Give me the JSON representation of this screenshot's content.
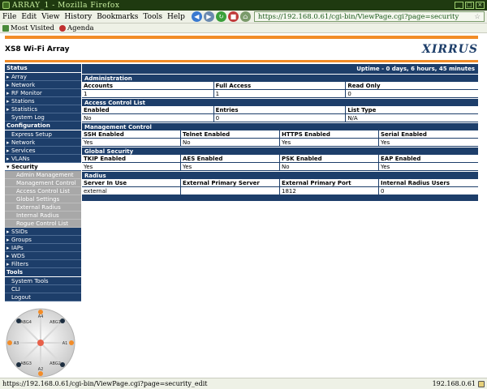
{
  "browser": {
    "window_title": "ARRAY_1 - Mozilla Firefox",
    "menus": [
      "File",
      "Edit",
      "View",
      "History",
      "Bookmarks",
      "Tools",
      "Help"
    ],
    "url": "https://192.168.0.61/cgi-bin/ViewPage.cgi?page=security",
    "bookmarks": [
      "Most Visited",
      "Agenda"
    ]
  },
  "page": {
    "title": "XS8 Wi-Fi Array",
    "logo": "XIRRUS",
    "uptime": "Uptime - 0 days, 6 hours, 45 minutes"
  },
  "sidebar": {
    "status_header": "Status",
    "status_items": [
      "Array",
      "Network",
      "RF Monitor",
      "Stations",
      "Statistics",
      "System Log"
    ],
    "config_header": "Configuration",
    "config_items_top": [
      "Express Setup",
      "Network",
      "Services",
      "VLANs"
    ],
    "security_label": "Security",
    "security_subitems": [
      "Admin Management",
      "Management Control",
      "Access Control List",
      "Global Settings",
      "External Radius",
      "Internal Radius",
      "Rogue Control List"
    ],
    "config_items_bottom": [
      "SSIDs",
      "Groups",
      "IAPs",
      "WDS",
      "Filters"
    ],
    "tools_header": "Tools",
    "tools_items": [
      "System Tools",
      "CLI",
      "Logout"
    ]
  },
  "admin": {
    "title": "Administration",
    "headers": [
      "Accounts",
      "Full Access",
      "Read Only"
    ],
    "values": [
      "1",
      "1",
      "0"
    ]
  },
  "acl": {
    "title": "Access Control List",
    "headers": [
      "Enabled",
      "Entries",
      "List Type"
    ],
    "values": [
      "No",
      "0",
      "N/A"
    ]
  },
  "mgmt": {
    "title": "Management Control",
    "headers": [
      "SSH Enabled",
      "Telnet Enabled",
      "HTTPS Enabled",
      "Serial Enabled"
    ],
    "values": [
      "Yes",
      "No",
      "Yes",
      "Yes"
    ]
  },
  "global": {
    "title": "Global Security",
    "headers": [
      "TKIP Enabled",
      "AES Enabled",
      "PSK Enabled",
      "EAP Enabled"
    ],
    "values": [
      "Yes",
      "Yes",
      "No",
      "Yes"
    ]
  },
  "radius": {
    "title": "Radius",
    "headers": [
      "Server In Use",
      "External Primary Server",
      "External Primary Port",
      "Internal Radius Users"
    ],
    "values": [
      "external",
      "",
      "1812",
      "0"
    ]
  },
  "device": {
    "labels": [
      "A4",
      "ABG1",
      "A1",
      "ABG2",
      "A2",
      "ABG3",
      "A3",
      "ABG4"
    ],
    "colors": {
      "orange": "#f28c28",
      "dark": "#1d2e40",
      "center": "#e8604a"
    }
  },
  "statusbar": {
    "link": "https://192.168.0.61/cgi-bin/ViewPage.cgi?page=security_edit",
    "host": "192.168.0.61"
  }
}
